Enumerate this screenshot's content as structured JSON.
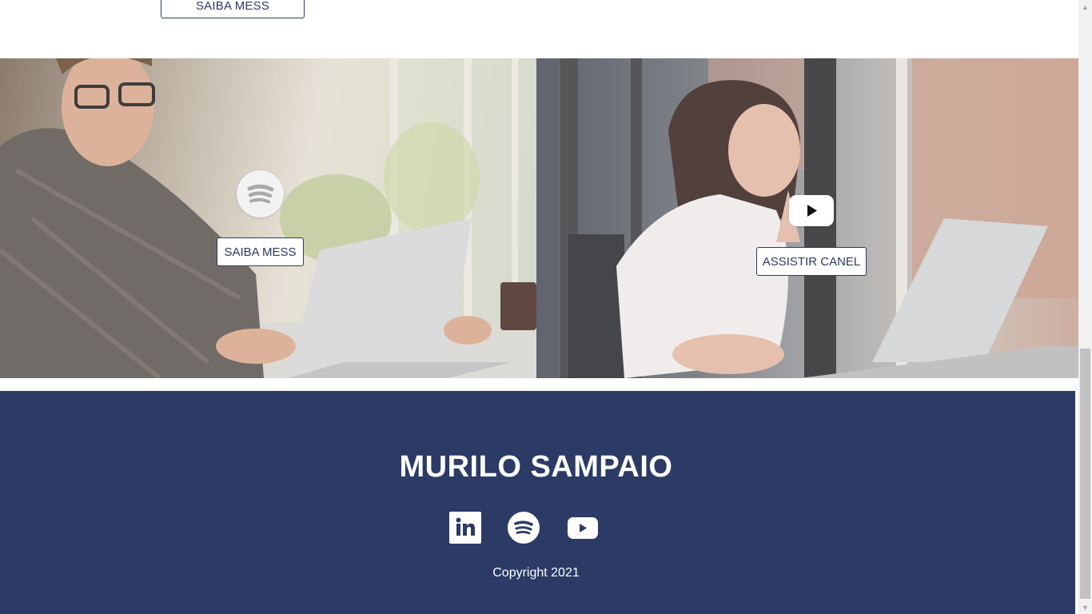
{
  "top_section": {
    "button_label": "SAIBA MESS"
  },
  "panels": {
    "left": {
      "button_label": "SAIBA MESS",
      "icon": "spotify-icon"
    },
    "right": {
      "button_label": "ASSISTIR CANEL",
      "icon": "youtube-icon"
    }
  },
  "footer": {
    "title": "MURILO SAMPAIO",
    "social": [
      {
        "name": "linkedin-icon",
        "label": "in"
      },
      {
        "name": "spotify-icon"
      },
      {
        "name": "youtube-icon"
      }
    ],
    "copyright": "Copyright 2021"
  },
  "colors": {
    "navy": "#2b3b66",
    "button_border": "#2c3a63",
    "white": "#ffffff"
  }
}
